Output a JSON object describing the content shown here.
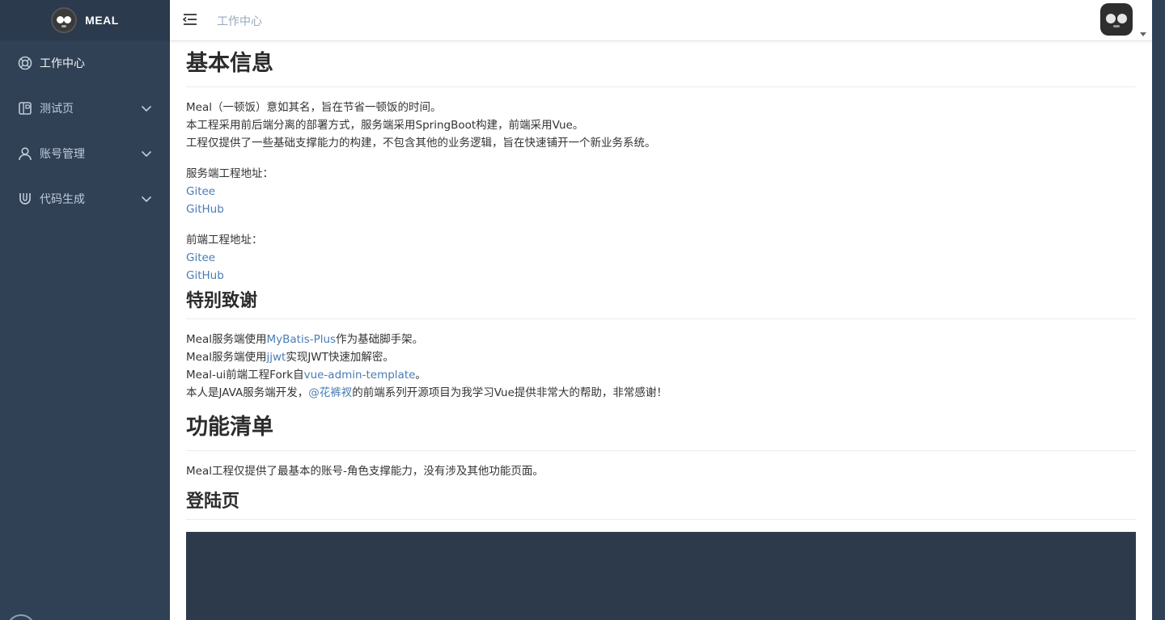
{
  "sidebar": {
    "logo_text": "MEAL",
    "items": [
      {
        "label": "工作中心",
        "icon": "dashboard-icon"
      },
      {
        "label": "测试页",
        "icon": "test-page-icon"
      },
      {
        "label": "账号管理",
        "icon": "user-icon"
      },
      {
        "label": "代码生成",
        "icon": "magnet-icon"
      }
    ]
  },
  "header": {
    "breadcrumb": "工作中心"
  },
  "content": {
    "basic_info": {
      "title": "基本信息",
      "lines": [
        "Meal（一顿饭）意如其名，旨在节省一顿饭的时间。",
        "本工程采用前后端分离的部署方式，服务端采用SpringBoot构建，前端采用Vue。",
        "工程仅提供了一些基础支撑能力的构建，不包含其他的业务逻辑，旨在快速铺开一个新业务系统。"
      ],
      "server_label": "服务端工程地址：",
      "server_links": [
        "Gitee",
        "GitHub"
      ],
      "frontend_label": "前端工程地址：",
      "frontend_links": [
        "Gitee",
        "GitHub"
      ]
    },
    "thanks": {
      "title": "特别致谢",
      "line1_pre": "Meal服务端使用",
      "line1_link": "MyBatis-Plus",
      "line1_post": "作为基础脚手架。",
      "line2_pre": "Meal服务端使用",
      "line2_link": "jjwt",
      "line2_post": "实现JWT快速加解密。",
      "line3_pre": "Meal-ui前端工程Fork自",
      "line3_link": "vue-admin-template",
      "line3_post": "。",
      "line4_pre": "本人是JAVA服务端开发，",
      "line4_link": "@花裤衩",
      "line4_post": "的前端系列开源项目为我学习Vue提供非常大的帮助，非常感谢！"
    },
    "features": {
      "title": "功能清单",
      "line": "Meal工程仅提供了最基本的账号-角色支撑能力，没有涉及其他功能页面。"
    },
    "login": {
      "title": "登陆页"
    }
  },
  "colors": {
    "sidebar_bg": "#304156",
    "sidebar_text": "#bfcbd9",
    "link": "#4a7cb5",
    "login_preview_bg": "#2d3a4b"
  }
}
